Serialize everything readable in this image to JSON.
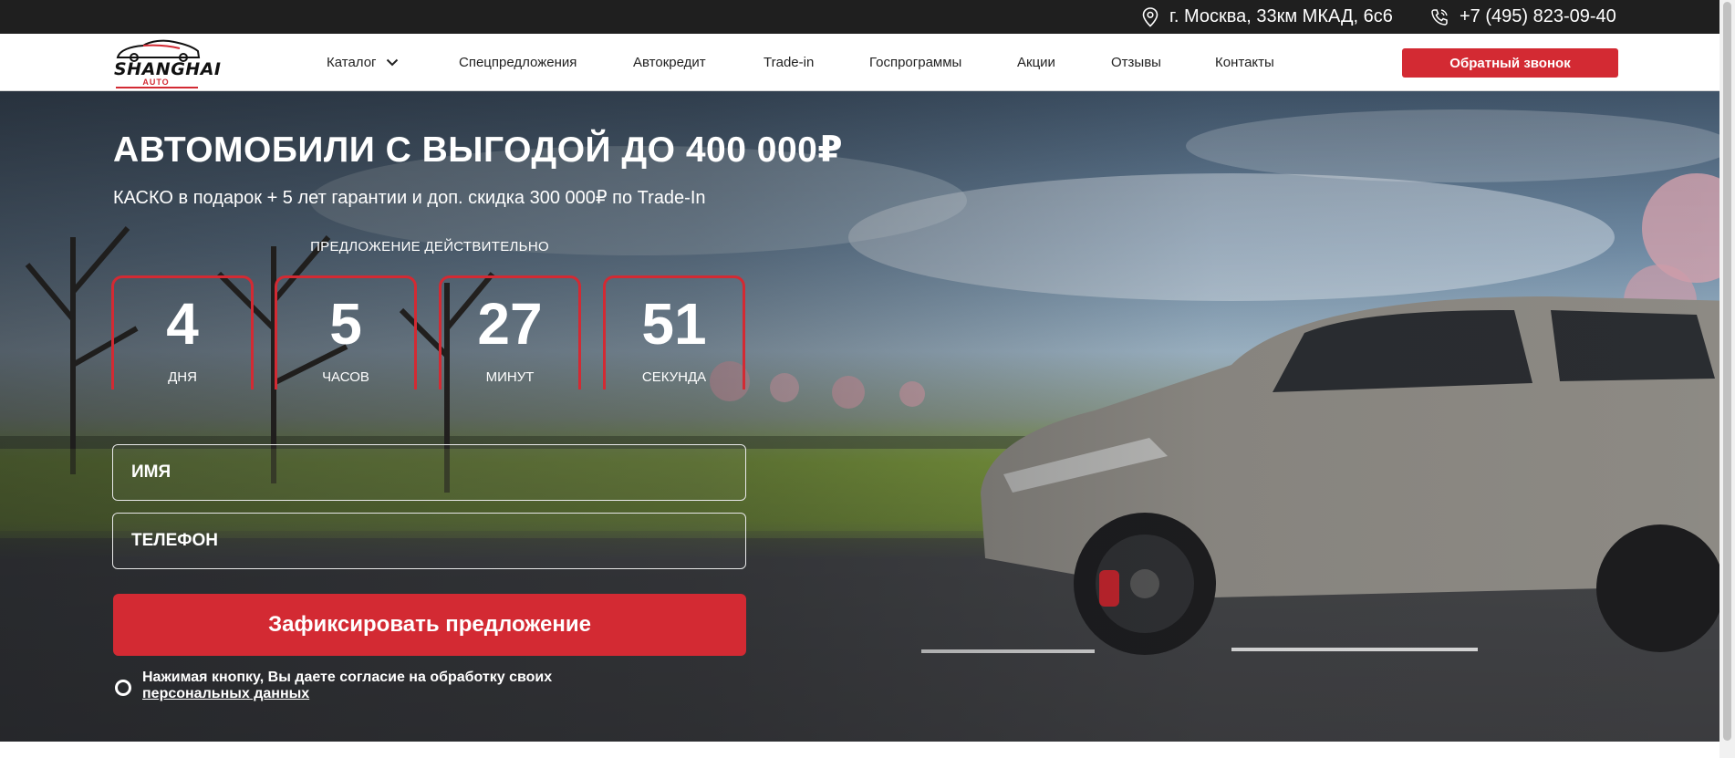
{
  "topbar": {
    "address": "г. Москва, 33км МКАД, 6с6",
    "phone": "+7 (495) 823-09-40"
  },
  "logo": {
    "brand": "SHANGHAI",
    "sub": "AUTO"
  },
  "nav": {
    "items": [
      {
        "label": "Каталог"
      },
      {
        "label": "Спецпредложения"
      },
      {
        "label": "Автокредит"
      },
      {
        "label": "Trade-in"
      },
      {
        "label": "Госпрограммы"
      },
      {
        "label": "Акции"
      },
      {
        "label": "Отзывы"
      },
      {
        "label": "Контакты"
      }
    ],
    "callback_label": "Обратный звонок"
  },
  "hero": {
    "title": "АВТОМОБИЛИ С ВЫГОДОЙ ДО 400 000₽",
    "subtitle": "КАСКО в подарок + 5 лет гарантии и доп. скидка 300 000₽ по Trade-In",
    "offer_label": "ПРЕДЛОЖЕНИЕ ДЕЙСТВИТЕЛЬНО",
    "countdown": [
      {
        "value": "4",
        "unit": "ДНЯ"
      },
      {
        "value": "5",
        "unit": "ЧАСОВ"
      },
      {
        "value": "27",
        "unit": "МИНУТ"
      },
      {
        "value": "51",
        "unit": "СЕКУНДА"
      }
    ]
  },
  "form": {
    "name_placeholder": "ИМЯ",
    "phone_placeholder": "ТЕЛЕФОН",
    "submit_label": "Зафиксировать предложение",
    "consent_text": "Нажимая кнопку, Вы даете согласие на обработку своих",
    "consent_link": "персональных данных"
  },
  "colors": {
    "accent": "#d32a33",
    "topbar": "#1f1f1f"
  }
}
